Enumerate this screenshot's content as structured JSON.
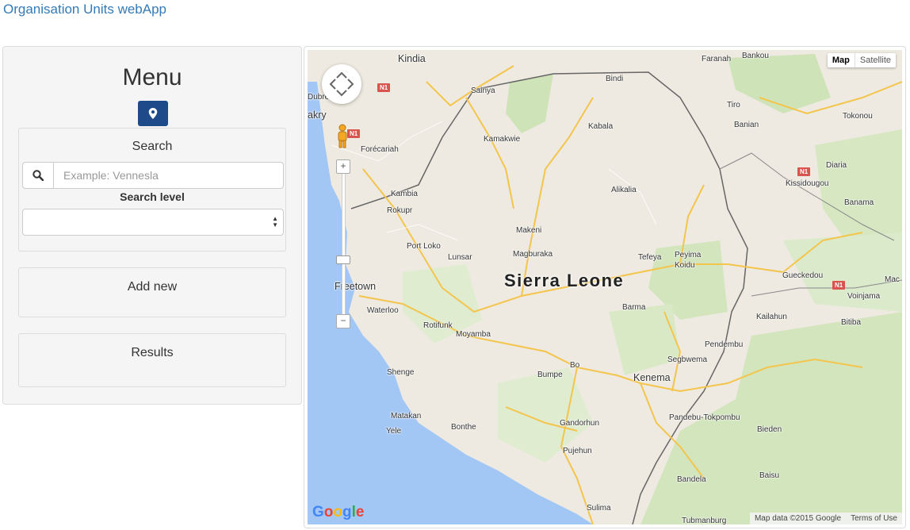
{
  "app": {
    "title": "Organisation Units webApp"
  },
  "menu": {
    "title": "Menu",
    "pin_icon": "map-marker-icon",
    "search": {
      "title": "Search",
      "placeholder": "Example: Vennesla",
      "level_label": "Search level",
      "level_value": ""
    },
    "add_new_label": "Add new",
    "results_label": "Results"
  },
  "map": {
    "type_buttons": [
      "Map",
      "Satellite"
    ],
    "country_label": "Sierra Leone",
    "places": {
      "kindia": "Kindia",
      "faranah": "Faranah",
      "bankou": "Bankou",
      "dubreka": "Dubrék",
      "conakry": "akry",
      "sainya": "Sainya",
      "bindi": "Bindi",
      "tiro": "Tiro",
      "banian": "Banian",
      "tokonou": "Tokonou",
      "kabala": "Kabala",
      "forecariah": "Forécariah",
      "kamakwie": "Kamakwie",
      "diaria": "Diaria",
      "kissidougou": "Kissidougou",
      "kambia": "Kambia",
      "alikalia": "Alikalia",
      "banama": "Banama",
      "rokupr": "Rokupr",
      "makeni": "Makeni",
      "portloko": "Port Loko",
      "lunsar": "Lunsar",
      "magburaka": "Magburaka",
      "tefeya": "Tefeya",
      "peyima": "Peyima",
      "koidu": "Koidu",
      "gueckedou": "Gueckedou",
      "mac": "Mac",
      "freetown": "Freetown",
      "waterloo": "Waterloo",
      "barma": "Barma",
      "voinjama": "Voinjama",
      "kailahun": "Kailahun",
      "rotifunk": "Rotifunk",
      "bitiba": "Bitiba",
      "moyamba": "Moyamba",
      "pendembu": "Pendembu",
      "segbwema": "Segbwema",
      "shenge": "Shenge",
      "bo": "Bo",
      "bumpe": "Bumpe",
      "kenema": "Kenema",
      "matakan": "Matakan",
      "yele": "Yele",
      "pandebu": "Pandebu-Tokpombu",
      "bonthe": "Bonthe",
      "gandorhun": "Gandorhun",
      "bieden": "Bieden",
      "pujehun": "Pujehun",
      "bandela": "Bandela",
      "baisu": "Baisu",
      "sulima": "Sulima",
      "tubmanburg": "Tubmanburg"
    },
    "road_badges": [
      "N1",
      "N1",
      "N1",
      "N1"
    ],
    "zoom_in": "+",
    "zoom_out": "−",
    "zoom_out_lower": "−",
    "google_logo": "Google",
    "attribution": "Map data ©2015 Google",
    "terms": "Terms of Use"
  },
  "colors": {
    "link": "#337ab7",
    "pin_button": "#1e4a8a",
    "water": "#a3c7f5",
    "land": "#efeae1",
    "forest": "#cfe3b8",
    "road": "#f4c54c"
  }
}
